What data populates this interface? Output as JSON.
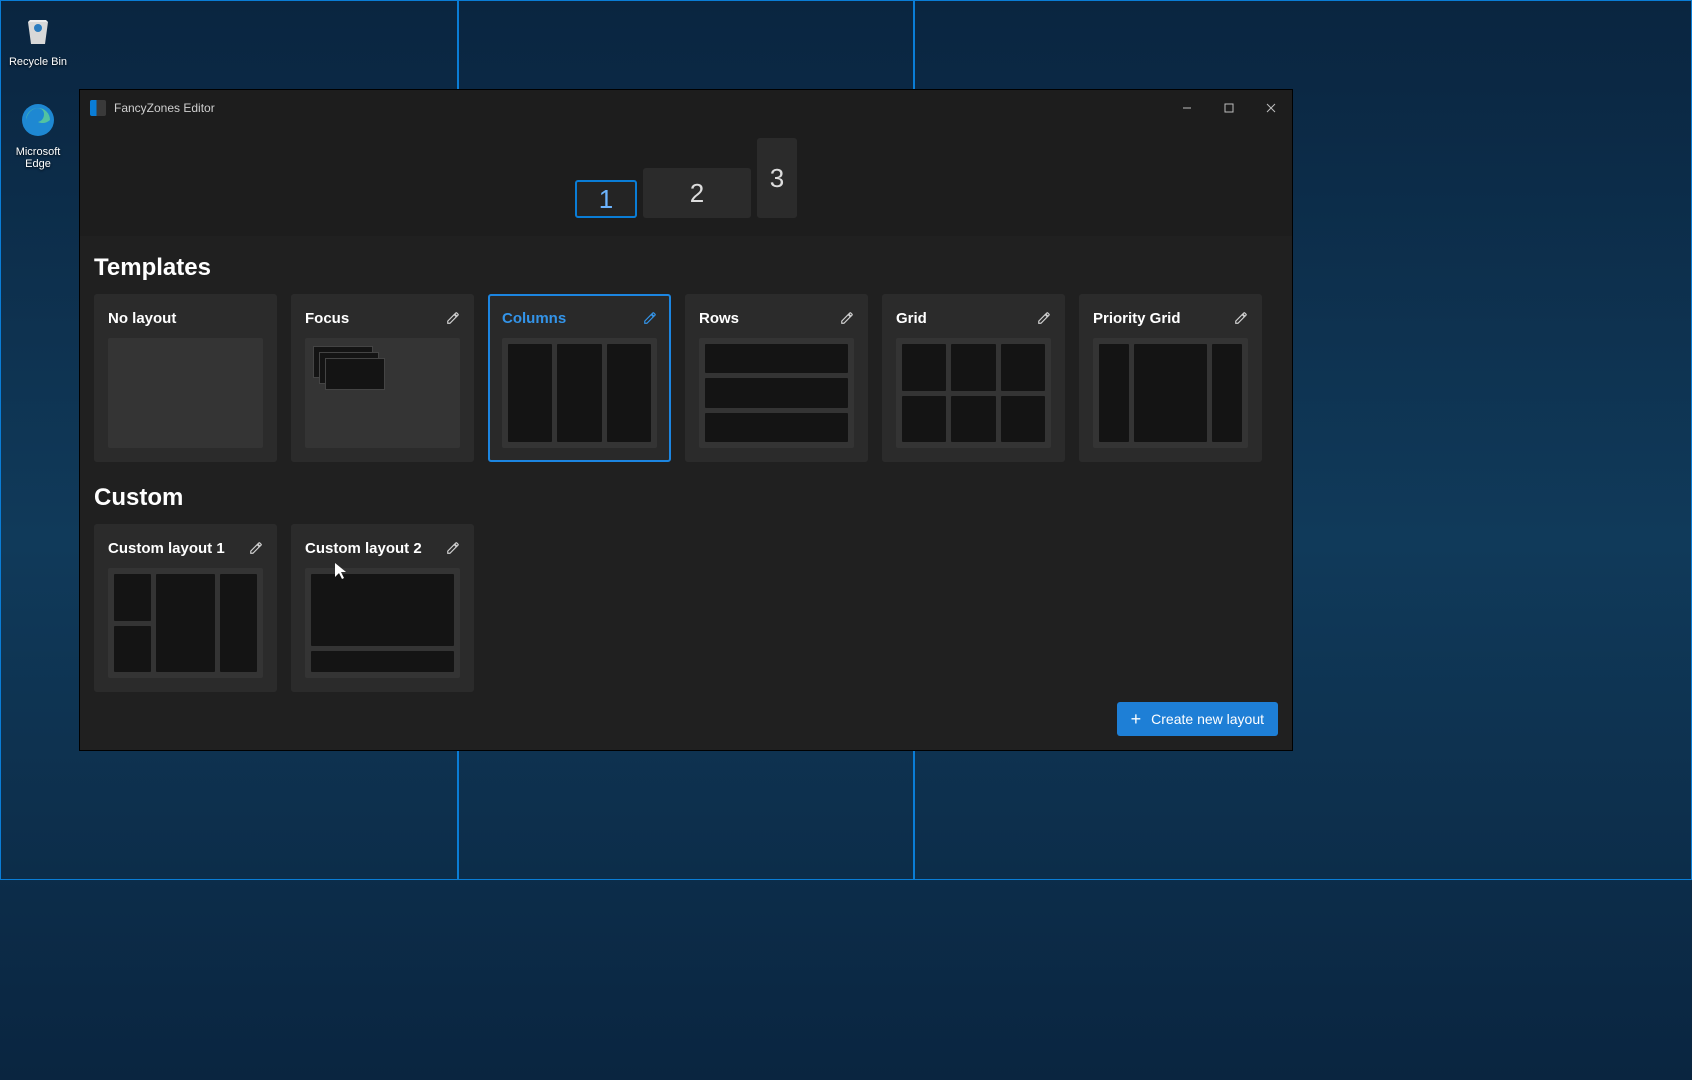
{
  "desktop": {
    "icons": {
      "recycle_bin": "Recycle Bin",
      "edge": "Microsoft Edge"
    }
  },
  "window": {
    "title": "FancyZones Editor",
    "monitors": [
      "1",
      "2",
      "3"
    ],
    "selected_monitor_index": 0
  },
  "sections": {
    "templates_label": "Templates",
    "custom_label": "Custom"
  },
  "templates": [
    {
      "name": "No layout",
      "editable": false,
      "selected": false,
      "preview": "empty"
    },
    {
      "name": "Focus",
      "editable": true,
      "selected": false,
      "preview": "focus"
    },
    {
      "name": "Columns",
      "editable": true,
      "selected": true,
      "preview": "columns"
    },
    {
      "name": "Rows",
      "editable": true,
      "selected": false,
      "preview": "rows"
    },
    {
      "name": "Grid",
      "editable": true,
      "selected": false,
      "preview": "grid"
    },
    {
      "name": "Priority Grid",
      "editable": true,
      "selected": false,
      "preview": "priority"
    }
  ],
  "custom_layouts": [
    {
      "name": "Custom layout 1",
      "editable": true,
      "preview": "custom1"
    },
    {
      "name": "Custom layout 2",
      "editable": true,
      "preview": "custom2"
    }
  ],
  "actions": {
    "create_new_layout": "Create new layout"
  },
  "colors": {
    "accent": "#1e7fd6"
  }
}
